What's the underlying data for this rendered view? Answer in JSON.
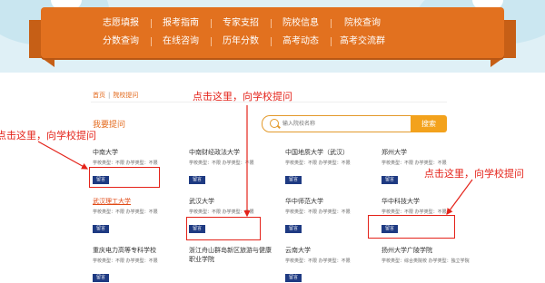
{
  "nav": {
    "row1": [
      "志愿填报",
      "报考指南",
      "专家支招",
      "院校信息",
      "院校查询"
    ],
    "row2": [
      "分数查询",
      "在线咨询",
      "历年分数",
      "高考动态",
      "高考交流群"
    ]
  },
  "breadcrumb": {
    "home": "首页",
    "current": "院校提问"
  },
  "section_title": "我要提问",
  "search": {
    "placeholder": "输入院校名称",
    "button": "搜索"
  },
  "message_label": "留言",
  "meta_default": "学校类型：不限 办学类型：不限",
  "colleges": [
    {
      "name": "中南大学"
    },
    {
      "name": "中南财经政法大学"
    },
    {
      "name": "中国地质大学（武汉）"
    },
    {
      "name": "郑州大学"
    },
    {
      "name": "武汉理工大学"
    },
    {
      "name": "武汉大学"
    },
    {
      "name": "华中师范大学"
    },
    {
      "name": "华中科技大学"
    },
    {
      "name": "重庆电力高等专科学校"
    },
    {
      "name": "浙江舟山群岛新区旅游与健康职业学院"
    },
    {
      "name": "云南大学"
    },
    {
      "name": "扬州大学广陵学院"
    }
  ],
  "meta_last": "学校类型：综合类院校 办学类型：独立学院",
  "annotations": [
    "点击这里，向学校提问",
    "点击这里，向学校提问",
    "点击这里，向学校提问"
  ],
  "colors": {
    "banner": "#e2711f",
    "accent": "#e36a1c",
    "annotation": "#e4231a",
    "message_button": "#1e3a82"
  }
}
